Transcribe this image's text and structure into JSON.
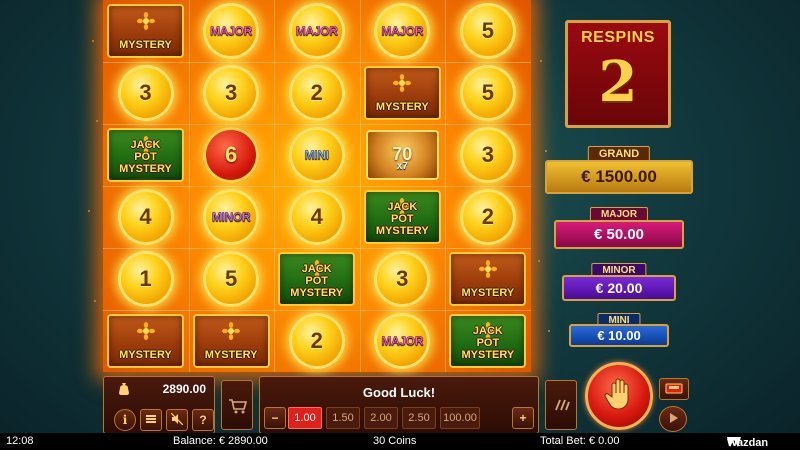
{
  "grid": {
    "rows": [
      [
        {
          "type": "mystery",
          "text": "MYSTERY"
        },
        {
          "type": "jackpot_coin",
          "label": "MAJOR",
          "tier": "major"
        },
        {
          "type": "jackpot_coin",
          "label": "MAJOR",
          "tier": "major"
        },
        {
          "type": "jackpot_coin",
          "label": "MAJOR",
          "tier": "major"
        },
        {
          "type": "coin",
          "value": "5"
        }
      ],
      [
        {
          "type": "coin",
          "value": "3"
        },
        {
          "type": "coin",
          "value": "3"
        },
        {
          "type": "coin",
          "value": "2"
        },
        {
          "type": "mystery",
          "text": "MYSTERY"
        },
        {
          "type": "coin",
          "value": "5"
        }
      ],
      [
        {
          "type": "jackpot_mystery",
          "text": "JACK POT MYSTERY"
        },
        {
          "type": "red_coin",
          "value": "6"
        },
        {
          "type": "jackpot_coin",
          "label": "MINI",
          "tier": "mini"
        },
        {
          "type": "pot",
          "value": "70",
          "multiplier": "x7"
        },
        {
          "type": "coin",
          "value": "3"
        }
      ],
      [
        {
          "type": "coin",
          "value": "4"
        },
        {
          "type": "jackpot_coin",
          "label": "MINOR",
          "tier": "minor"
        },
        {
          "type": "coin",
          "value": "4"
        },
        {
          "type": "jackpot_mystery",
          "text": "JACK POT MYSTERY"
        },
        {
          "type": "coin",
          "value": "2"
        }
      ],
      [
        {
          "type": "coin",
          "value": "1"
        },
        {
          "type": "coin",
          "value": "5"
        },
        {
          "type": "jackpot_mystery",
          "text": "JACK POT MYSTERY"
        },
        {
          "type": "coin",
          "value": "3"
        },
        {
          "type": "mystery",
          "text": "MYSTERY"
        }
      ],
      [
        {
          "type": "mystery",
          "text": "MYSTERY"
        },
        {
          "type": "mystery",
          "text": "MYSTERY"
        },
        {
          "type": "coin",
          "value": "2"
        },
        {
          "type": "jackpot_coin",
          "label": "MAJOR",
          "tier": "major"
        },
        {
          "type": "jackpot_mystery",
          "text": "JACK POT MYSTERY"
        }
      ]
    ]
  },
  "respins": {
    "label": "RESPINS",
    "count": "2"
  },
  "jackpots": {
    "grand": {
      "label": "GRAND",
      "amount": "€ 1500.00",
      "color": "#d7a21e"
    },
    "major": {
      "label": "MAJOR",
      "amount": "€ 50.00",
      "color": "#c0106a"
    },
    "minor": {
      "label": "MINOR",
      "amount": "€ 20.00",
      "color": "#6a1ab8"
    },
    "mini": {
      "label": "MINI",
      "amount": "€ 10.00",
      "color": "#1a4ab8"
    }
  },
  "controls": {
    "balance_amount": "2890.00",
    "message": "Good Luck!",
    "bet_options": [
      "1.00",
      "1.50",
      "2.00",
      "2.50",
      "100.00"
    ],
    "selected_bet": "1.00",
    "minus_label": "−",
    "plus_label": "+",
    "info_label": "i",
    "help_label": "?"
  },
  "status_bar": {
    "time": "12:08",
    "balance": "Balance: € 2890.00",
    "coins": "30 Coins",
    "total_bet": "Total Bet: € 0.00",
    "brand": "Wazdan"
  },
  "icons": [
    "money-bag-icon",
    "info-icon",
    "menu-icon",
    "sound-off-icon",
    "help-icon",
    "cart-icon",
    "autoplay-icon",
    "stop-hand-icon",
    "gamble-icon",
    "turbo-icon",
    "wazdan-logo-icon"
  ]
}
